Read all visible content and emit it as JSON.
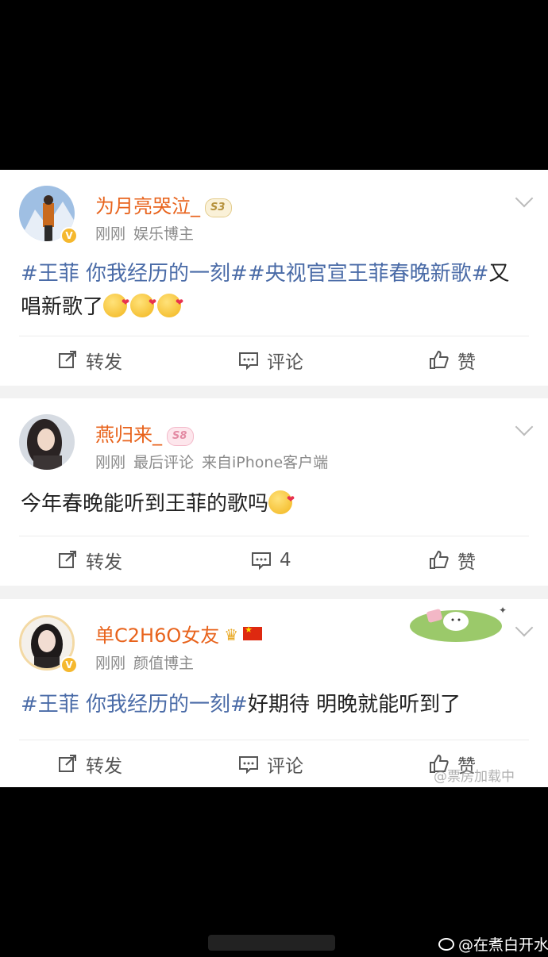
{
  "posts": [
    {
      "username": "为月亮哭泣_",
      "level": "S3",
      "time": "刚刚",
      "tag_label": "娱乐博主",
      "extra_meta": "",
      "content_parts": [
        {
          "text": "#王菲 你我经历的一刻##央视官宣王菲春晚新歌#",
          "tag": true
        },
        {
          "text": "又唱新歌了",
          "tag": false
        }
      ],
      "emoji_count": 3,
      "repost_label": "转发",
      "comment_label": "评论",
      "like_label": "赞"
    },
    {
      "username": "燕归来_",
      "level": "S8",
      "time": "刚刚",
      "tag_label": "最后评论",
      "extra_meta": "来自iPhone客户端",
      "content_parts": [
        {
          "text": "今年春晚能听到王菲的歌吗",
          "tag": false
        }
      ],
      "emoji_count": 1,
      "repost_label": "转发",
      "comment_label": "4",
      "like_label": "赞"
    },
    {
      "username": "单C2H6O女友",
      "level": "",
      "time": "刚刚",
      "tag_label": "颜值博主",
      "extra_meta": "",
      "content_parts": [
        {
          "text": "#王菲 你我经历的一刻#",
          "tag": true
        },
        {
          "text": "好期待 明晚就能听到了",
          "tag": false
        }
      ],
      "emoji_count": 0,
      "repost_label": "转发",
      "comment_label": "评论",
      "like_label": "赞"
    }
  ],
  "watermark_inner": "@票房加载中",
  "watermark_outer": "@在煮白开水",
  "colors": {
    "username": "#e8631c",
    "hashtag": "#4a6ba7",
    "meta": "#8a8a8a",
    "background": "#000000"
  }
}
